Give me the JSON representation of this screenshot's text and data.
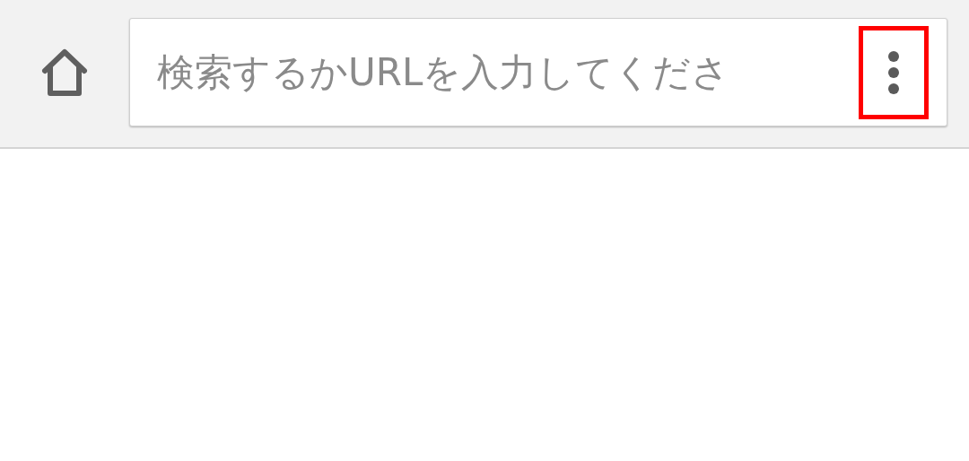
{
  "toolbar": {
    "search": {
      "placeholder": "検索するかURLを入力してくださ"
    },
    "menu_button": {
      "highlighted": true
    }
  }
}
